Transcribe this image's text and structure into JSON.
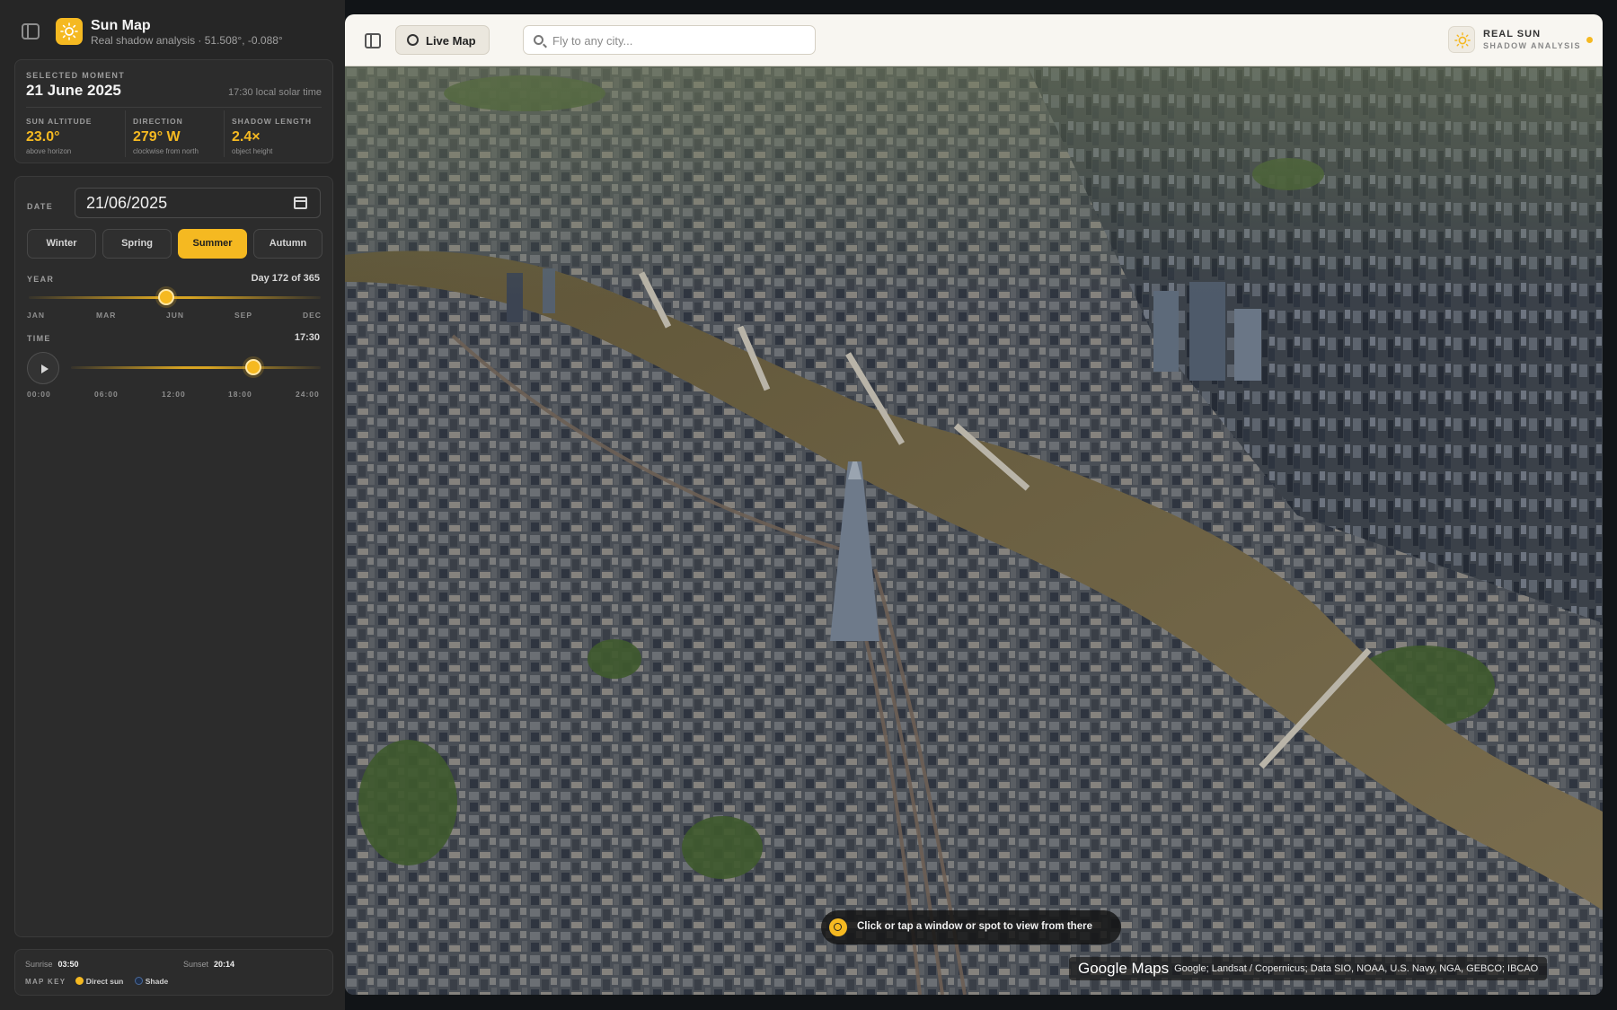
{
  "app": {
    "title": "Sun Map",
    "subtitle": "Real shadow analysis · 51.508°, -0.088°"
  },
  "moment": {
    "label": "SELECTED MOMENT",
    "date": "21 June 2025",
    "local_time": "17:30 local solar time"
  },
  "stats": [
    {
      "label": "SUN ALTITUDE",
      "value": "23.0°",
      "note": "above horizon"
    },
    {
      "label": "DIRECTION",
      "value": "279° W",
      "note": "clockwise from north"
    },
    {
      "label": "SHADOW LENGTH",
      "value": "2.4×",
      "note": "object height"
    }
  ],
  "controls": {
    "date_label": "DATE",
    "date_value": "21/06/2025",
    "seasons": [
      {
        "label": "Winter",
        "active": false
      },
      {
        "label": "Spring",
        "active": false
      },
      {
        "label": "Summer",
        "active": true
      },
      {
        "label": "Autumn",
        "active": false
      }
    ],
    "year_label": "YEAR",
    "year_value": "Day 172 of 365",
    "year_fraction": 0.471,
    "year_ticks": [
      "JAN",
      "MAR",
      "JUN",
      "SEP",
      "DEC"
    ],
    "time_label": "TIME",
    "time_value": "17:30",
    "time_fraction": 0.729,
    "time_ticks": [
      "00:00",
      "06:00",
      "12:00",
      "18:00",
      "24:00"
    ]
  },
  "info": {
    "sunrise_label": "Sunrise",
    "sunrise": "03:50",
    "sunset_label": "Sunset",
    "sunset": "20:14",
    "map_key_label": "MAP KEY",
    "key_sun": "Direct sun",
    "key_shade": "Shade"
  },
  "topbar": {
    "live_map": "Live Map",
    "search_placeholder": "Fly to any city...",
    "badge_title": "REAL SUN",
    "badge_sub": "SHADOW ANALYSIS"
  },
  "map": {
    "hint": "Click or tap a window or spot to view from there",
    "brand": "Google Maps",
    "credits": "Google; Landsat / Copernicus; Data SIO, NOAA, U.S. Navy, NGA, GEBCO; IBCAO"
  },
  "colors": {
    "accent": "#f5b921",
    "sidebar_bg": "#262626",
    "topbar_bg": "#f8f6f1",
    "river": "#6e6244"
  }
}
